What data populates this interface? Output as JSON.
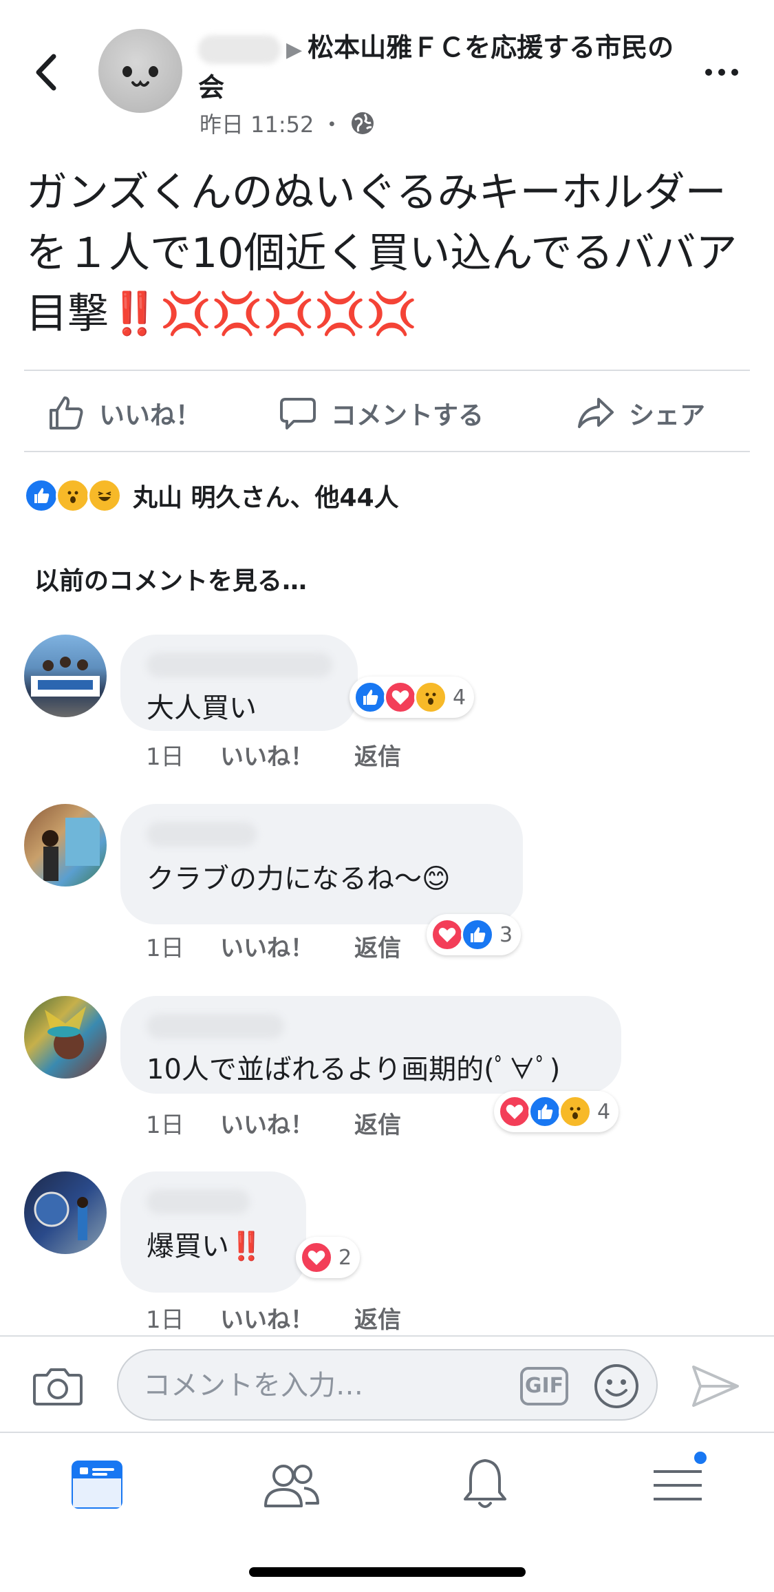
{
  "header": {
    "title": "松本山雅ＦＣを応援する市民の会",
    "arrow": "▶",
    "time": "昨日 11:52",
    "separator": "・"
  },
  "post": {
    "text": "ガンズくんのぬいぐるみキーホルダーを１人で10個近く買い込んでるババア目撃",
    "emoji": "‼️💢💢💢💢💢"
  },
  "actions": {
    "like": "いいね！",
    "comment": "コメントする",
    "share": "シェア"
  },
  "reactions": {
    "summary": "丸山 明久さん、他44人",
    "icons": [
      "like-icon",
      "wow-icon",
      "haha-icon"
    ]
  },
  "previous_comments": "以前のコメントを見る…",
  "comments": [
    {
      "text": "大人買い",
      "reactions": [
        "like",
        "love",
        "wow"
      ],
      "count": "4",
      "time": "1日",
      "like": "いいね！",
      "reply": "返信"
    },
    {
      "text": "クラブの力になるね〜😊",
      "reactions": [
        "love",
        "like"
      ],
      "count": "3",
      "time": "1日",
      "like": "いいね！",
      "reply": "返信"
    },
    {
      "text": "10人で並ばれるより画期的(ﾟ∀ﾟ)",
      "reactions": [
        "love",
        "like",
        "wow"
      ],
      "count": "4",
      "time": "1日",
      "like": "いいね！",
      "reply": "返信"
    },
    {
      "text": "爆買い",
      "excl": "‼️",
      "reactions": [
        "love"
      ],
      "count": "2",
      "time": "1日",
      "like": "いいね！",
      "reply": "返信"
    }
  ],
  "composer": {
    "placeholder": "コメントを入力…",
    "gif": "GIF"
  },
  "colors": {
    "accent": "#1877f2",
    "love": "#f33e58",
    "wow": "#f7b928",
    "text": "#1c1e21",
    "secondary": "#65676b"
  },
  "tabs": [
    "news-feed-icon",
    "friends-icon",
    "notifications-icon",
    "menu-icon"
  ]
}
